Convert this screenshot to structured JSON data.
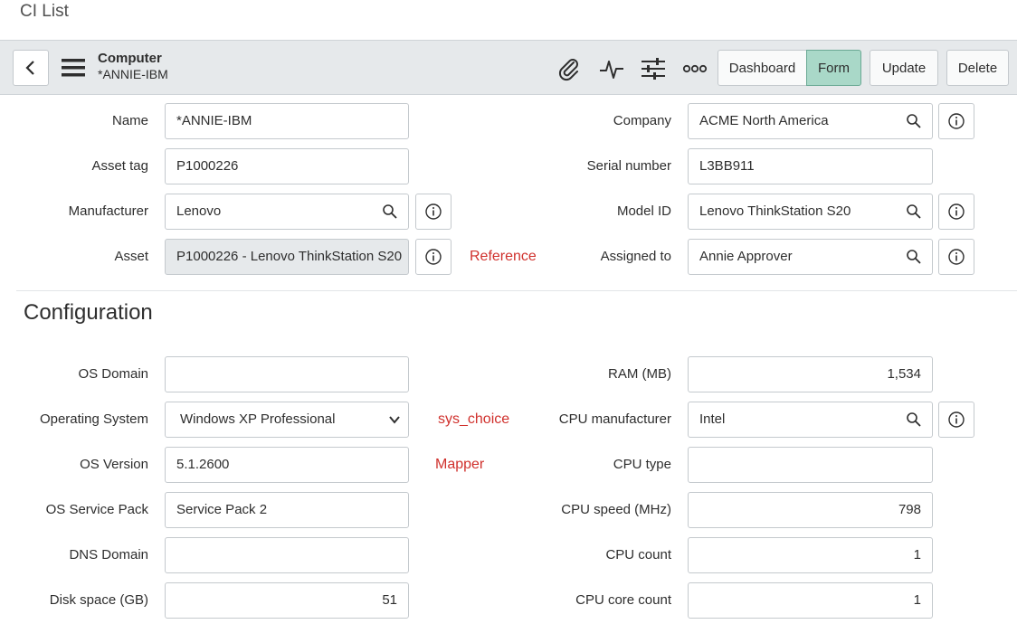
{
  "page": {
    "title": "CI List"
  },
  "header": {
    "record_type": "Computer",
    "record_name": "*ANNIE-IBM",
    "buttons": {
      "dashboard": "Dashboard",
      "form": "Form",
      "update": "Update",
      "delete": "Delete"
    },
    "icons": [
      "back-icon",
      "hamburger-menu-icon",
      "paperclip-icon",
      "activity-icon",
      "settings-sliders-icon",
      "more-options-icon"
    ]
  },
  "fields": {
    "name": {
      "label": "Name",
      "value": "*ANNIE-IBM"
    },
    "asset_tag": {
      "label": "Asset tag",
      "value": "P1000226"
    },
    "manufacturer": {
      "label": "Manufacturer",
      "value": "Lenovo"
    },
    "asset": {
      "label": "Asset",
      "value": "P1000226 - Lenovo ThinkStation S20"
    },
    "company": {
      "label": "Company",
      "value": "ACME North America"
    },
    "serial_number": {
      "label": "Serial number",
      "value": "L3BB911"
    },
    "model_id": {
      "label": "Model ID",
      "value": "Lenovo ThinkStation S20"
    },
    "assigned_to": {
      "label": "Assigned to",
      "value": "Annie Approver"
    }
  },
  "configuration": {
    "title": "Configuration",
    "os_domain": {
      "label": "OS Domain",
      "value": ""
    },
    "operating_system": {
      "label": "Operating System",
      "value": "Windows XP Professional"
    },
    "os_version": {
      "label": "OS Version",
      "value": "5.1.2600"
    },
    "os_service_pack": {
      "label": "OS Service Pack",
      "value": "Service Pack 2"
    },
    "dns_domain": {
      "label": "DNS Domain",
      "value": ""
    },
    "disk_space": {
      "label": "Disk space (GB)",
      "value": "51"
    },
    "ram": {
      "label": "RAM (MB)",
      "value": "1,534"
    },
    "cpu_manufacturer": {
      "label": "CPU manufacturer",
      "value": "Intel"
    },
    "cpu_type": {
      "label": "CPU type",
      "value": ""
    },
    "cpu_speed": {
      "label": "CPU speed (MHz)",
      "value": "798"
    },
    "cpu_count": {
      "label": "CPU count",
      "value": "1"
    },
    "cpu_core_count": {
      "label": "CPU core count",
      "value": "1"
    }
  },
  "annotations": {
    "reference": "Reference",
    "sys_choice": "sys_choice",
    "mapper": "Mapper"
  },
  "colors": {
    "accent_active": "#a9d8c8",
    "header_bg": "#e6e9eb",
    "annotation_red": "#d0312d"
  }
}
